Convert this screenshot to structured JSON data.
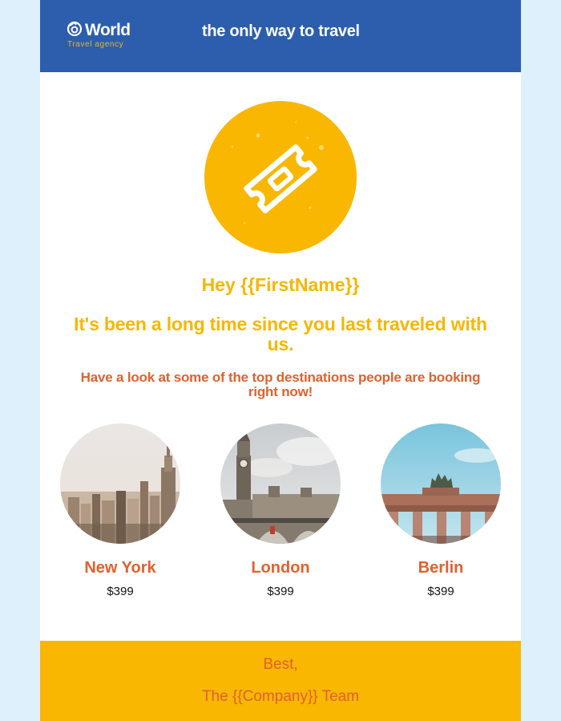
{
  "header": {
    "logo_word": "World",
    "logo_sub": "Travel agency",
    "tagline": "the only way to travel",
    "logo_icon": "compass-icon"
  },
  "hero": {
    "icon": "ticket-icon",
    "greeting": "Hey {{FirstName}}",
    "headline": "It's been a long time since you last traveled with us.",
    "subhead": "Have a look at some of the top destinations people are booking right now!"
  },
  "destinations": [
    {
      "name": "New York",
      "price": "$399"
    },
    {
      "name": "London",
      "price": "$399"
    },
    {
      "name": "Berlin",
      "price": "$399"
    }
  ],
  "footer": {
    "signoff": "Best,",
    "team": "The {{Company}} Team"
  },
  "colors": {
    "header_bg": "#2c5ead",
    "accent_yellow": "#f9b702",
    "accent_orange": "#e0612d",
    "page_bg": "#dff0fd"
  }
}
